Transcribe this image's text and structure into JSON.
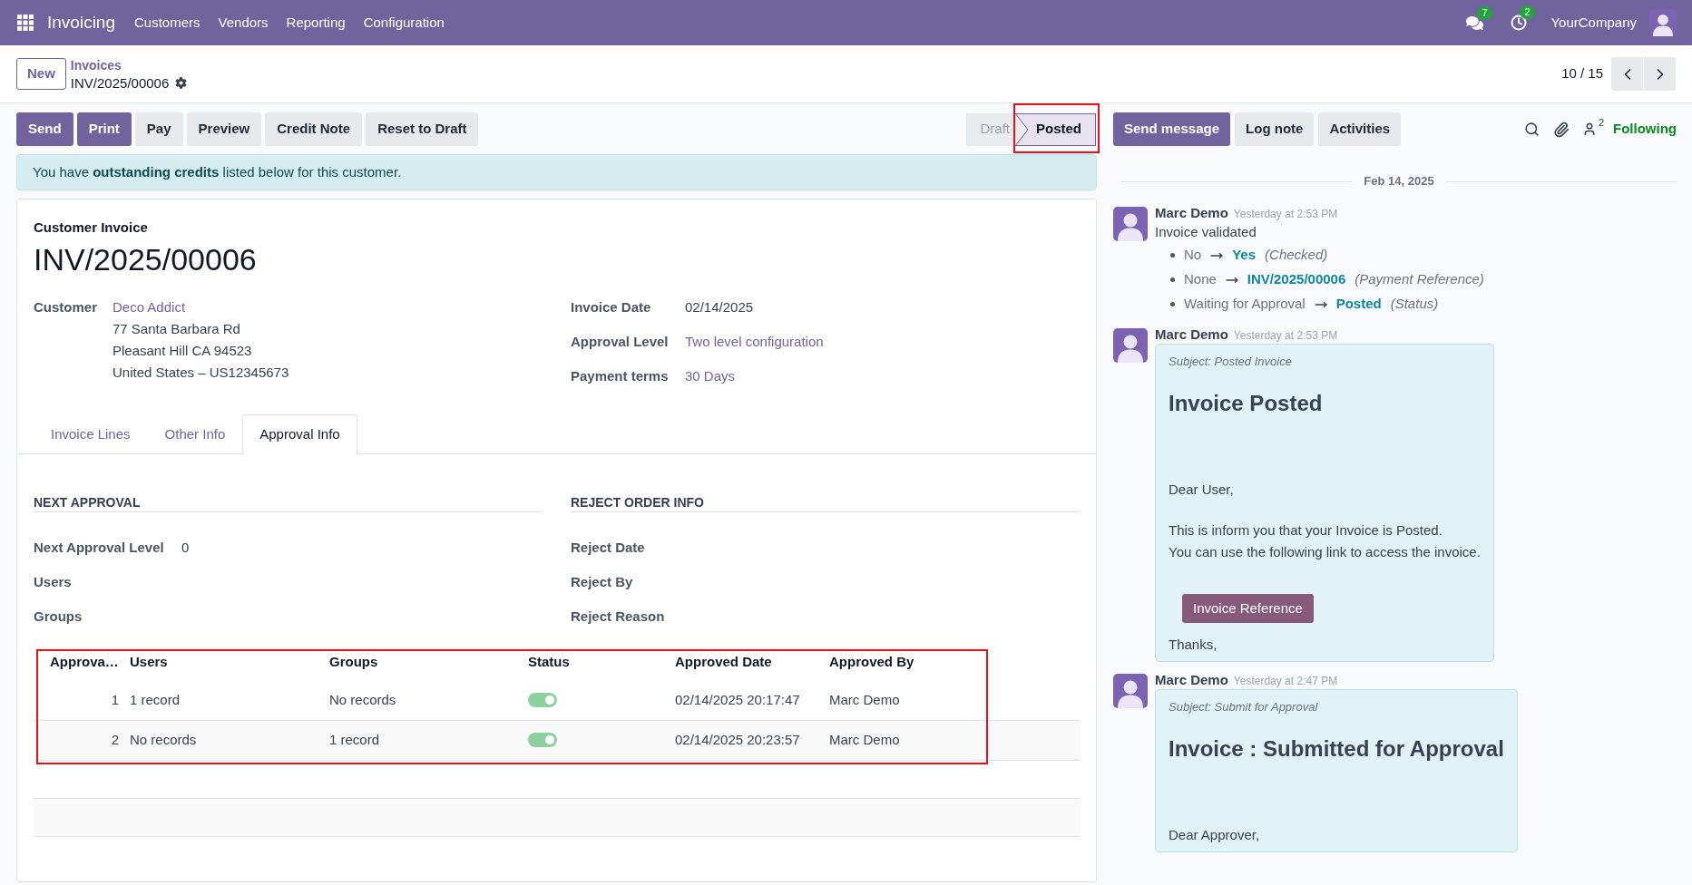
{
  "navbar": {
    "app_name": "Invoicing",
    "menu": [
      "Customers",
      "Vendors",
      "Reporting",
      "Configuration"
    ],
    "messages_count": "7",
    "activities_count": "2",
    "company": "YourCompany"
  },
  "control_panel": {
    "new_button": "New",
    "breadcrumb": [
      "Invoices"
    ],
    "record_name": "INV/2025/00006",
    "pager": "10 / 15"
  },
  "action_buttons": [
    {
      "label": "Send",
      "primary": true
    },
    {
      "label": "Print",
      "primary": true
    },
    {
      "label": "Pay",
      "primary": false
    },
    {
      "label": "Preview",
      "primary": false
    },
    {
      "label": "Credit Note",
      "primary": false
    },
    {
      "label": "Reset to Draft",
      "primary": false
    }
  ],
  "statusbar": [
    {
      "label": "Draft",
      "selected": false,
      "highlighted": false
    },
    {
      "label": "Posted",
      "selected": true,
      "highlighted": true
    }
  ],
  "alert": "You have **outstanding credits** listed below for this customer.",
  "sheet": {
    "type_label": "Customer Invoice",
    "name": "INV/2025/00006",
    "customer": {
      "label": "Customer",
      "name": "Deco Addict",
      "address": [
        "77 Santa Barbara Rd",
        "Pleasant Hill CA 94523",
        "United States – US12345673"
      ]
    },
    "fields": [
      {
        "label": "Invoice Date",
        "value": "02/14/2025",
        "kind": "text"
      },
      {
        "label": "Approval Level",
        "value": "Two level configuration",
        "kind": "link"
      },
      {
        "label": "Payment terms",
        "value": "30 Days",
        "kind": "link"
      }
    ],
    "tabs": [
      {
        "label": "Invoice Lines",
        "selected": false
      },
      {
        "label": "Other Info",
        "selected": false
      },
      {
        "label": "Approval Info",
        "selected": true
      }
    ],
    "sections": [
      {
        "title": "NEXT APPROVAL",
        "fields": [
          {
            "label": "Next Approval Level",
            "value": "0"
          },
          {
            "label": "Users"
          },
          {
            "label": "Groups"
          }
        ]
      },
      {
        "title": "REJECT ORDER INFO",
        "fields": [
          {
            "label": "Reject Date"
          },
          {
            "label": "Reject By"
          },
          {
            "label": "Reject Reason"
          }
        ]
      }
    ],
    "approvals_table": {
      "highlighted": true,
      "columns": [
        "Approva…",
        "Users",
        "Groups",
        "Status",
        "Approved Date",
        "Approved By"
      ],
      "rows": [
        {
          "number": "1",
          "users": "1 record",
          "groups": "No records",
          "on": true,
          "approved_date": "02/14/2025 20:17:47",
          "approved_by": "Marc Demo"
        },
        {
          "number": "2",
          "users": "No records",
          "groups": "1 record",
          "on": true,
          "approved_date": "02/14/2025 20:23:57",
          "approved_by": "Marc Demo"
        }
      ]
    }
  },
  "chatter": {
    "buttons": [
      {
        "label": "Send message",
        "primary": true
      },
      {
        "label": "Log note",
        "primary": false
      },
      {
        "label": "Activities",
        "primary": false
      }
    ],
    "followers_count": "2",
    "follow_label": "Following",
    "date_separator": "Feb 14, 2025",
    "messages": [
      {
        "kind": "tracking",
        "author": "Marc Demo",
        "time": "Yesterday at 2:53 PM",
        "body": "Invoice validated",
        "changes": [
          {
            "old": "No",
            "new": "Yes",
            "field": "(Checked)"
          },
          {
            "old": "None",
            "new": "INV/2025/00006",
            "field": "(Payment Reference)"
          },
          {
            "old": "Waiting for Approval",
            "new": "Posted",
            "field": "(Status)"
          }
        ]
      },
      {
        "kind": "email",
        "author": "Marc Demo",
        "time": "Yesterday at 2:53 PM",
        "subject": "Subject: Posted Invoice",
        "heading": "Invoice Posted",
        "blocks": [
          {
            "kind": "text",
            "lines": [
              "Dear User,"
            ]
          },
          {
            "kind": "text",
            "lines": [
              "This is inform you that your Invoice is Posted.",
              "You can use the following link to access the invoice."
            ]
          },
          {
            "kind": "button",
            "label": "Invoice Reference"
          },
          {
            "kind": "text",
            "lines": [
              "Thanks,"
            ]
          }
        ]
      },
      {
        "kind": "email",
        "author": "Marc Demo",
        "time": "Yesterday at 2:47 PM",
        "subject": "Subject: Submit for Approval",
        "heading": "Invoice : Submitted for Approval",
        "blocks": [
          {
            "kind": "text",
            "lines": [
              "Dear Approver,"
            ]
          }
        ]
      }
    ]
  }
}
